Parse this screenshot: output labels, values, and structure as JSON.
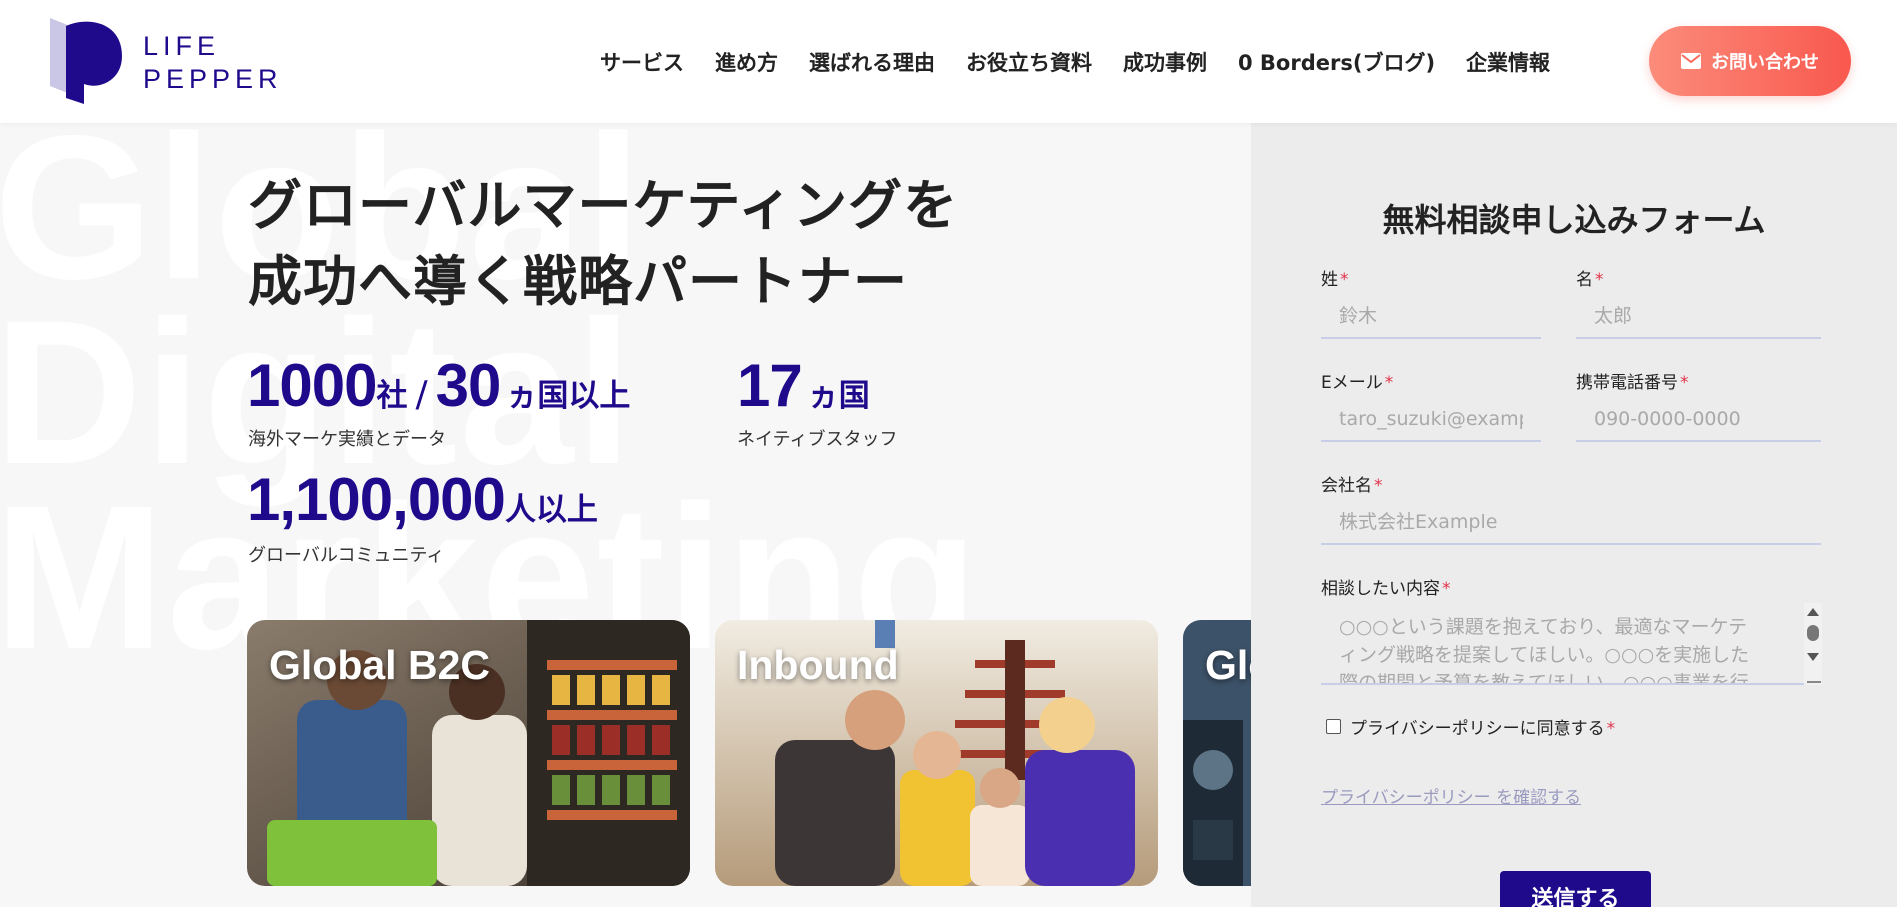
{
  "header": {
    "logo_line1": "LIFE",
    "logo_line2": "PEPPER",
    "nav": [
      "サービス",
      "進め方",
      "選ばれる理由",
      "お役立ち資料",
      "成功事例",
      "0 Borders(ブログ)",
      "企業情報"
    ],
    "contact_label": "お問い合わせ"
  },
  "hero": {
    "bg_words": [
      "Global",
      "Digital",
      "Marketing"
    ],
    "title_line1": "グローバルマーケティングを",
    "title_line2": "成功へ導く戦略パートナー",
    "stats": {
      "companies_num": "1000",
      "companies_unit": "社",
      "separator": "/",
      "countries_num": "30",
      "countries_unit": "ヵ国以上",
      "stat1_label": "海外マーケ実績とデータ",
      "native_num": "17",
      "native_unit": "ヵ国",
      "native_label": "ネイティブスタッフ",
      "community_num": "1,100,000",
      "community_unit": "人以上",
      "community_label": "グローバルコミュニティ"
    },
    "cards": [
      {
        "title": "Global B2C"
      },
      {
        "title": "Inbound"
      },
      {
        "title": "Global"
      }
    ]
  },
  "form": {
    "title": "無料相談申し込みフォーム",
    "required_mark": "*",
    "last_name_label": "姓",
    "last_name_placeholder": "鈴木",
    "first_name_label": "名",
    "first_name_placeholder": "太郎",
    "email_label": "Eメール",
    "email_placeholder": "taro_suzuki@example.com",
    "phone_label": "携帯電話番号",
    "phone_placeholder": "090-0000-0000",
    "company_label": "会社名",
    "company_placeholder": "株式会社Example",
    "inquiry_label": "相談したい内容",
    "inquiry_placeholder": "○○○という課題を抱えており、最適なマーケティング戦略を提案してほしい。○○○を実施した際の期間と予算を教えてほしい。○○○事業を行っている",
    "privacy_checkbox_label": "プライバシーポリシーに同意する",
    "privacy_link": "プライバシーポリシー を確認する",
    "submit_label": "送信する"
  },
  "colors": {
    "brand": "#1f0a8c",
    "accent_from": "#fb8c7b",
    "accent_to": "#f9584e",
    "required": "#e0334a"
  }
}
